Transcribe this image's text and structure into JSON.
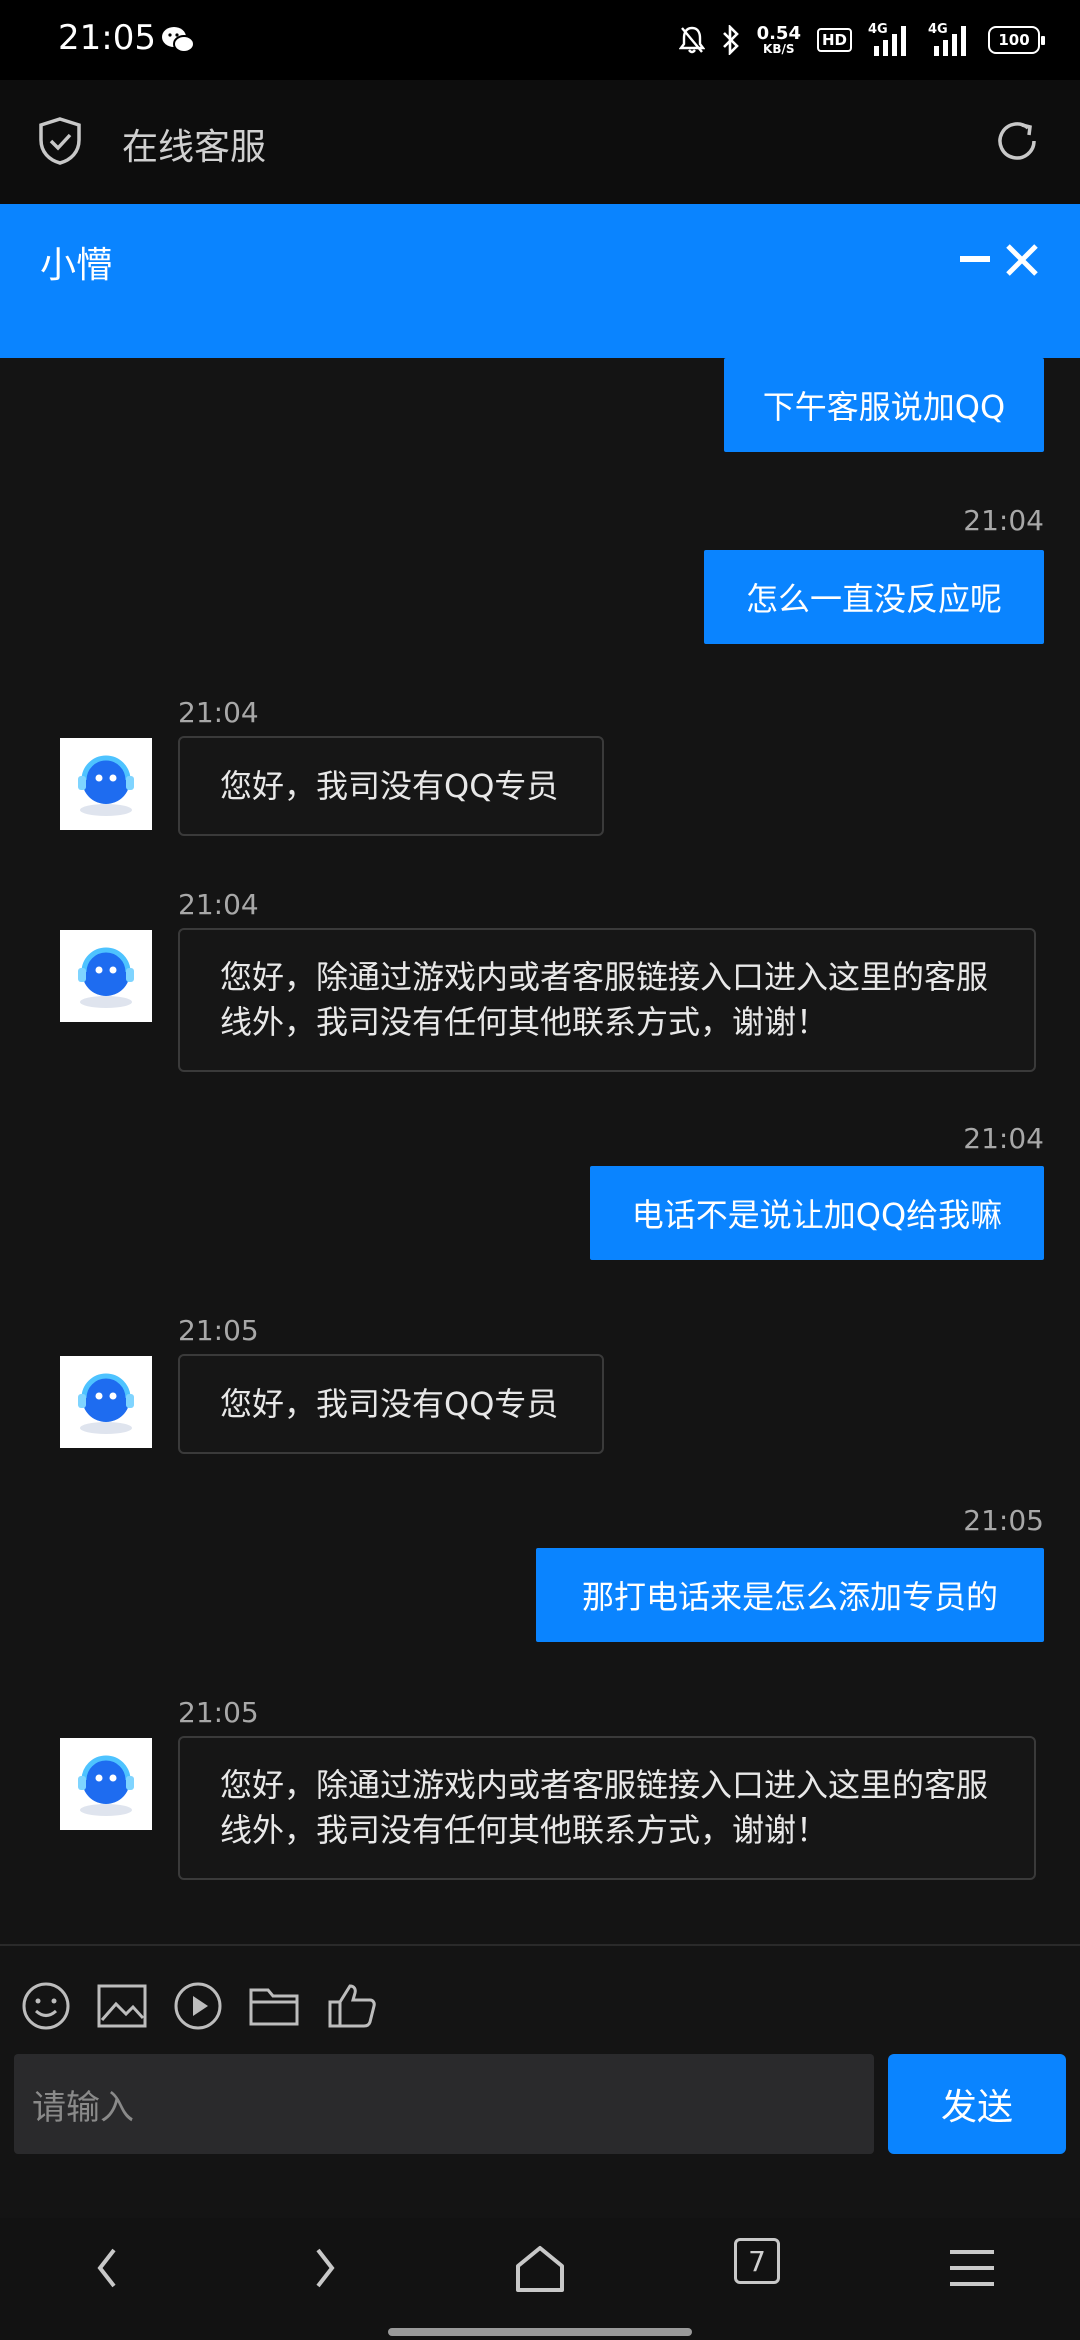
{
  "status_bar": {
    "time": "21:05",
    "net_speed": "0.54",
    "net_unit": "KB/S",
    "hd": "HD",
    "signal_1": "4G",
    "signal_2": "4G",
    "battery": "100"
  },
  "app_header": {
    "title": "在线客服"
  },
  "chat_header": {
    "name": "小懵"
  },
  "messages": [
    {
      "side": "out",
      "time": "",
      "text": "下午客服说加QQ"
    },
    {
      "side": "out",
      "time": "21:04",
      "text": "怎么一直没反应呢"
    },
    {
      "side": "in",
      "time": "21:04",
      "text": "您好，我司没有QQ专员"
    },
    {
      "side": "in",
      "time": "21:04",
      "text": "您好，除通过游戏内或者客服链接入口进入这里的客服线外，我司没有任何其他联系方式，谢谢！"
    },
    {
      "side": "out",
      "time": "21:04",
      "text": "电话不是说让加QQ给我嘛"
    },
    {
      "side": "in",
      "time": "21:05",
      "text": "您好，我司没有QQ专员"
    },
    {
      "side": "out",
      "time": "21:05",
      "text": "那打电话来是怎么添加专员的"
    },
    {
      "side": "in",
      "time": "21:05",
      "text": "您好，除通过游戏内或者客服链接入口进入这里的客服线外，我司没有任何其他联系方式，谢谢！"
    }
  ],
  "composer": {
    "placeholder": "请输入",
    "send_label": "发送",
    "tools": [
      "emoji-icon",
      "image-icon",
      "video-icon",
      "folder-icon",
      "thumbs-up-icon"
    ]
  },
  "nav_bar": {
    "tab_count": "7"
  },
  "colors": {
    "accent": "#0a84ff",
    "background": "#141414"
  }
}
